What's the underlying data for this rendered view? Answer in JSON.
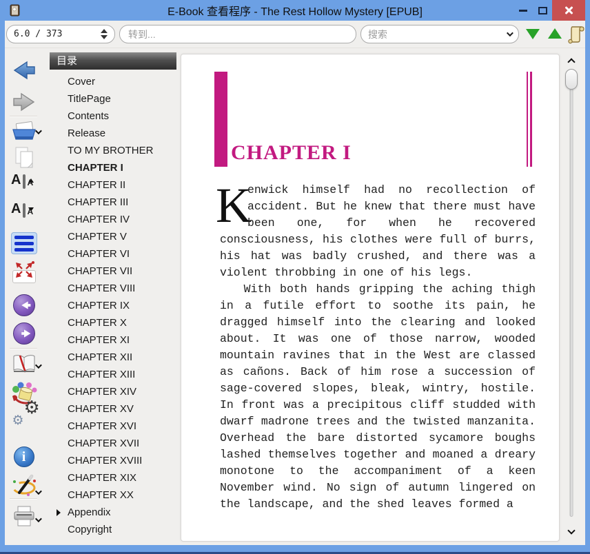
{
  "window": {
    "title": "E-Book 查看程序 - The Rest Hollow Mystery [EPUB]"
  },
  "toolbar": {
    "page_indicator": "6.0 / 373",
    "goto_placeholder": "转到...",
    "search_placeholder": "搜索"
  },
  "icon_names": [
    "back-icon",
    "forward-icon",
    "open-book-icon",
    "copy-pages-icon",
    "font-increase-icon",
    "font-decrease-icon",
    "line-spacing-icon",
    "fit-screen-icon",
    "prev-page-icon",
    "next-page-icon",
    "bookmarks-book-icon",
    "theme-paint-icon",
    "settings-gears-icon",
    "info-icon",
    "magic-wand-icon",
    "printer-icon",
    "scroll-parchment-icon",
    "search-down-icon",
    "search-up-icon",
    "gear-glyph",
    "info-glyph"
  ],
  "icon_glyphs": {
    "gear": "⚙",
    "info": "i"
  },
  "toc": {
    "header": "目录",
    "items": [
      {
        "label": "Cover"
      },
      {
        "label": "TitlePage"
      },
      {
        "label": "Contents"
      },
      {
        "label": "Release"
      },
      {
        "label": "TO MY BROTHER"
      },
      {
        "label": "CHAPTER I",
        "bold": true
      },
      {
        "label": "CHAPTER II"
      },
      {
        "label": "CHAPTER III"
      },
      {
        "label": "CHAPTER IV"
      },
      {
        "label": "CHAPTER V"
      },
      {
        "label": "CHAPTER VI"
      },
      {
        "label": "CHAPTER VII"
      },
      {
        "label": "CHAPTER VIII"
      },
      {
        "label": "CHAPTER IX"
      },
      {
        "label": "CHAPTER X"
      },
      {
        "label": "CHAPTER XI"
      },
      {
        "label": "CHAPTER XII"
      },
      {
        "label": "CHAPTER XIII"
      },
      {
        "label": "CHAPTER XIV"
      },
      {
        "label": "CHAPTER XV"
      },
      {
        "label": "CHAPTER XVI"
      },
      {
        "label": "CHAPTER XVII"
      },
      {
        "label": "CHAPTER XVIII"
      },
      {
        "label": "CHAPTER XIX"
      },
      {
        "label": "CHAPTER XX"
      },
      {
        "label": "Appendix",
        "expandable": true
      },
      {
        "label": "Copyright"
      }
    ]
  },
  "reader": {
    "chapter_title": "CHAPTER I",
    "paragraphs": [
      {
        "drop_cap": "K",
        "text": "enwick himself had no recollection of accident. But he knew that there must have been one, for when he recovered consciousness, his clothes were full of burrs, his hat was badly crushed, and there was a violent throbbing in one of his legs."
      },
      {
        "text": "With both hands gripping the aching thigh in a futile effort to soothe its pain, he dragged himself into the clearing and looked about. It was one of those narrow, wooded mountain ravines that in the West are classed as cañons. Back of him rose a succession of sage-covered slopes, bleak, wintry, hostile. In front was a precipitous cliff studded with dwarf madrone trees and the twisted manzanita. Overhead the bare distorted sycamore boughs lashed themselves together and moaned a dreary monotone to the accompaniment of a keen November wind. No sign of autumn lingered on the landscape, and the shed leaves formed a"
      }
    ]
  },
  "colors": {
    "titlebar_blue": "#6CA0E4",
    "border_navy": "#2B4A86",
    "panel_bg": "#F0EFED",
    "accent_magenta": "#C21A80",
    "close_red": "#C75050",
    "nav_green": "#28A228",
    "spacing_blue": "#1533CC"
  }
}
